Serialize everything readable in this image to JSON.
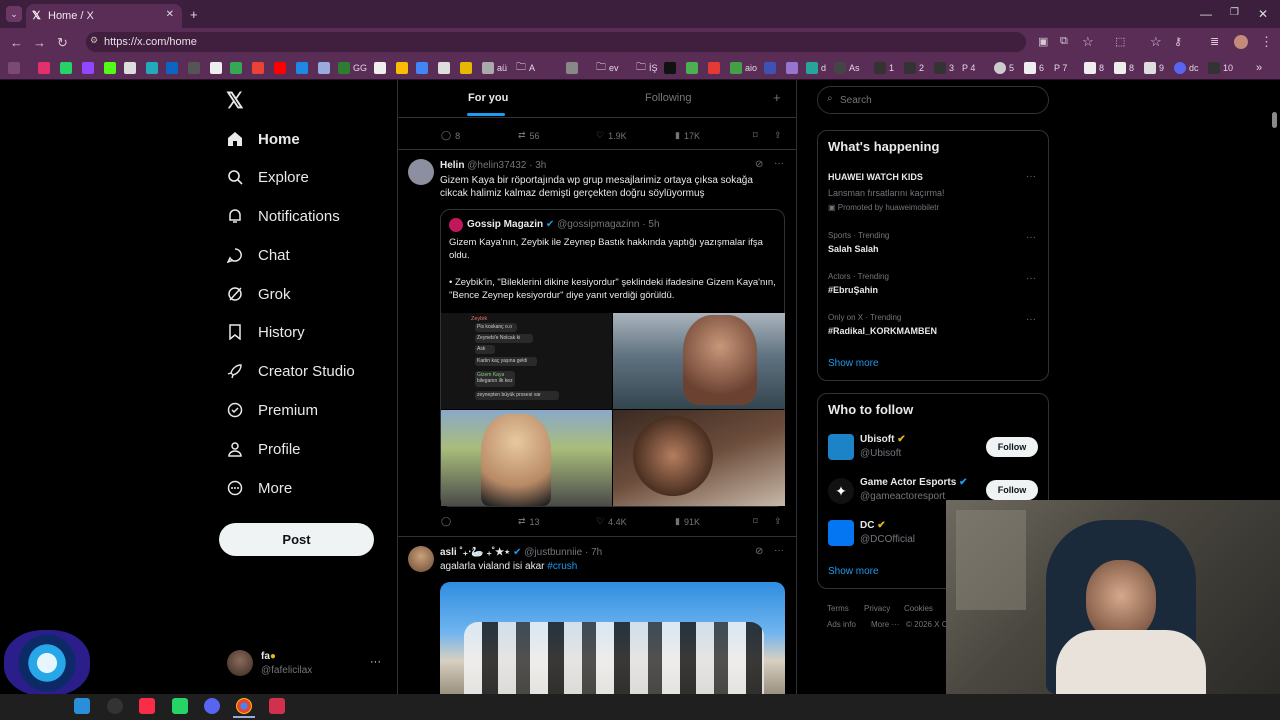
{
  "browser": {
    "tab_title": "Home / X",
    "url": "https://x.com/home",
    "bookmarks": [
      "GG",
      "aü",
      "A",
      "ev",
      "İŞ",
      "aio",
      "d",
      "As",
      "1",
      "2",
      "3",
      "P 4",
      "5",
      "6",
      "P 7",
      "8",
      "8",
      "9",
      "dc",
      "10"
    ]
  },
  "nav": {
    "home": "Home",
    "explore": "Explore",
    "notifications": "Notifications",
    "chat": "Chat",
    "grok": "Grok",
    "history": "History",
    "creator_studio": "Creator Studio",
    "premium": "Premium",
    "profile": "Profile",
    "more": "More",
    "post": "Post"
  },
  "account": {
    "name": "fa",
    "handle": "@fafelicilax"
  },
  "feed_tabs": {
    "for_you": "For you",
    "following": "Following"
  },
  "top_stats": {
    "replies": "8",
    "reposts": "56",
    "likes": "1.9K",
    "views": "17K"
  },
  "post1": {
    "name": "Helin",
    "handle": "@helin37432 · 3h",
    "text": "Gizem Kaya bir röportajında wp grup mesajlarimiz ortaya çıksa sokağa cikcak halimiz kalmaz demişti gerçekten doğru söylüyormuş",
    "quote": {
      "name": "Gossip Magazin",
      "handle": "@gossipmagazinn · 5h",
      "text1": "Gizem Kaya'nın, Zeybik ile Zeynep Bastık hakkında yaptığı yazışmalar ifşa oldu.",
      "text2": "• Zeybik'in, \"Bileklerini dikine kesiyordur\" şeklindeki ifadesine Gizem Kaya'nın, \"Bence Zeynep kesiyordur\" diye yanıt verdiği görüldü."
    },
    "chat_lines": [
      "Zeybik",
      "Pis koskanç o.o",
      "Zeynebi'e Nolcak ki",
      "Ask",
      "Kadın kaç yaşına geldi",
      "Gizem Kaya",
      "bileganın ilk kez",
      "zeynepten büyük prosesi var"
    ],
    "stats": {
      "replies": "",
      "reposts": "13",
      "likes": "4.4K",
      "views": "91K"
    }
  },
  "post2": {
    "name": "asli ˚₊‧🦢 ₊˚★⋆",
    "handle": "@justbunniie · 7h",
    "text": "agalarla vialand isi akar",
    "hashtag": "#crush"
  },
  "search": {
    "placeholder": "Search"
  },
  "whats_happening": {
    "title": "What's happening",
    "items": [
      {
        "meta": "HUAWEI WATCH KIDS",
        "title": "Lansman fırsatlarını kaçırma!",
        "sub": "Promoted by huaweimobiletr"
      },
      {
        "meta": "Sports · Trending",
        "title": "Salah Salah"
      },
      {
        "meta": "Actors · Trending",
        "title": "#EbruŞahin"
      },
      {
        "meta": "Only on X · Trending",
        "title": "#Radikal_KORKMAMBEN"
      }
    ],
    "show_more": "Show more"
  },
  "who_to_follow": {
    "title": "Who to follow",
    "items": [
      {
        "name": "Ubisoft",
        "handle": "@Ubisoft",
        "btn": "Follow"
      },
      {
        "name": "Game Actor Esports",
        "handle": "@gameactoresport",
        "btn": "Follow"
      },
      {
        "name": "DC",
        "handle": "@DCOfficial"
      }
    ],
    "show_more": "Show more"
  },
  "footer": {
    "terms": "Terms",
    "privacy": "Privacy",
    "cookies": "Cookies",
    "ads": "Ads info",
    "more": "More ···",
    "copy": "© 2026 X C"
  },
  "colors": {
    "accent": "#1d9bf0",
    "verified_gold": "#e2b719",
    "chrome": "#5a2d56"
  }
}
